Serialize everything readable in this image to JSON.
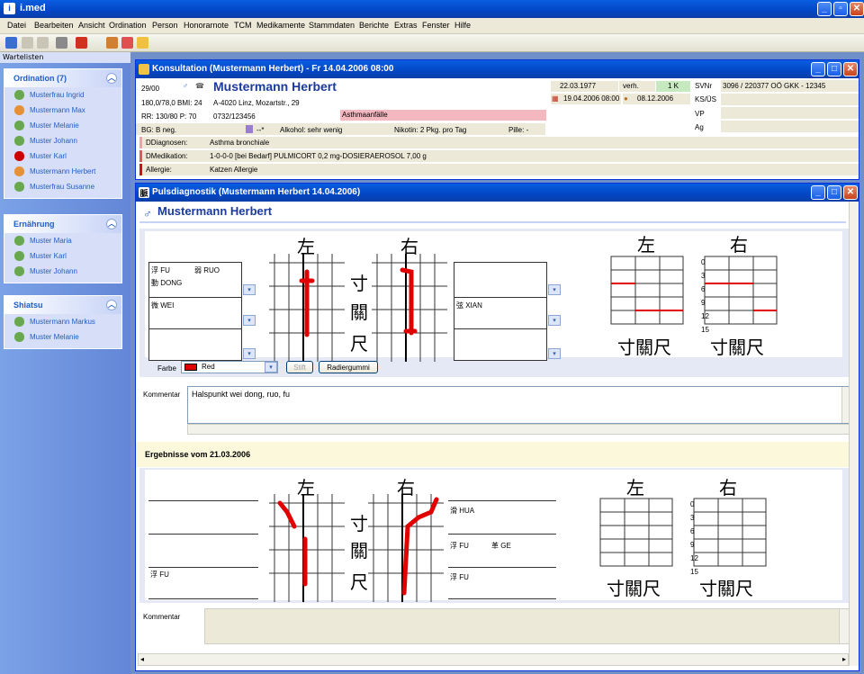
{
  "app": {
    "title": "i.med"
  },
  "menu": [
    "Datei",
    "Bearbeiten",
    "Ansicht",
    "Ordination",
    "Person",
    "Honorarnote",
    "TCM",
    "Medikamente",
    "Stammdaten",
    "Berichte",
    "Extras",
    "Fenster",
    "Hilfe"
  ],
  "sidebar": {
    "header": "Wartelisten",
    "groups": [
      {
        "title": "Ordination (7)",
        "items": [
          "Musterfrau Ingrid",
          "Mustermann Max",
          "Muster Melanie",
          "Muster Johann",
          "Muster Karl",
          "Mustermann Herbert",
          "Musterfrau Susanne"
        ]
      },
      {
        "title": "Ernährung",
        "items": [
          "Muster Maria",
          "Muster Karl",
          "Muster Johann"
        ]
      },
      {
        "title": "Shiatsu",
        "items": [
          "Mustermann Markus",
          "Muster Melanie"
        ]
      }
    ]
  },
  "consult": {
    "title": "Konsultation (Mustermann Herbert) - Fr 14.04.2006 08:00",
    "id": "29/00",
    "name": "Mustermann Herbert",
    "vitals": "180,0/78,0 BMI: 24",
    "address": "A-4020 Linz, Mozartstr., 29",
    "rr": "RR: 130/80 P: 70",
    "phone": "0732/123456",
    "alert": "Asthmaanfälle",
    "bg": "BG: B neg.",
    "dash": "--*",
    "alcohol": "Alkohol:  sehr wenig",
    "nicotine": "Nikotin:  2 Pkg. pro Tag",
    "pill": "Pille:  -",
    "dob": "22.03.1977",
    "marital": "verh.",
    "kids": "1 K",
    "next_appt": "19.04.2006 08:00",
    "last_date": "08.12.2006",
    "svnr_label": "SVNr",
    "svnr": "3096 / 220377 OÖ GKK - 12345",
    "ks_label": "KS/ÜS",
    "vp_label": "VP",
    "ag_label": "Ag",
    "diag_label": "DDiagnosen:",
    "diag": "Asthma bronchiale",
    "med_label": "DMedikation:",
    "med": "1-0-0-0 [bei Bedarf] PULMICORT 0,2 mg-DOSIERAEROSOL 7,00 g",
    "allergy_label": "Allergie:",
    "allergy": "Katzen Allergie"
  },
  "pulse": {
    "title": "Pulsdiagnostik (Mustermann Herbert 14.04.2006)",
    "name": "Mustermann Herbert",
    "left_col": [
      "浮 FU",
      "弱 RUO",
      "動 DONG",
      "微 WEI"
    ],
    "right_col": [
      "弦 XIAN"
    ],
    "kanji_left": "左",
    "kanji_right": "右",
    "kanji_cun": "寸",
    "kanji_guan": "關",
    "kanji_chi": "尺",
    "kanji_row": "寸關尺",
    "depth_ticks": [
      "0",
      "3",
      "6",
      "9",
      "12",
      "15"
    ],
    "farbe_label": "Farbe",
    "color_value": "Red",
    "color_hex": "#e00000",
    "stift": "Stift",
    "radier": "Radiergummi",
    "comment_label": "Kommentar",
    "comment": "Halspunkt wei dong, ruo, fu",
    "results_title": "Ergebnisse vom 21.03.2006",
    "res_left_col": [
      "浮 FU"
    ],
    "res_right_col": [
      "滑 HUA",
      "浮 FU",
      "革 GE",
      "浮 FU"
    ],
    "comment2_label": "Kommentar"
  }
}
